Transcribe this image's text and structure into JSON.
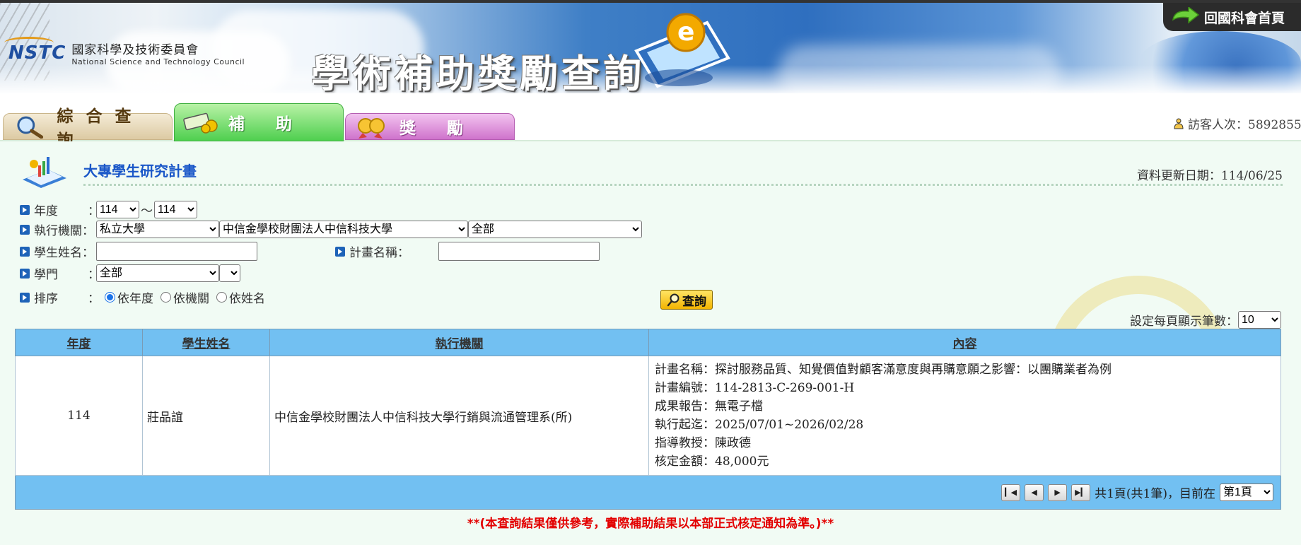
{
  "header": {
    "logo_mark": "NSTC",
    "logo_cn": "國家科學及技術委員會",
    "logo_en": "National Science and Technology Council",
    "site_title": "學術補助獎勵查詢",
    "home_link": "回國科會首頁"
  },
  "tabs": [
    {
      "label": "綜合查詢",
      "icon": "magnifier-icon",
      "color": "#dccaa3"
    },
    {
      "label": "補 助",
      "icon": "money-icon",
      "color": "#4fcf4f",
      "active": true
    },
    {
      "label": "獎 勵",
      "icon": "medal-icon",
      "color": "#cf73cc"
    }
  ],
  "visitor": {
    "label": "訪客人次：5892855"
  },
  "section": {
    "title": "大專學生研究計畫",
    "updated": "資料更新日期：114/06/25"
  },
  "form": {
    "year_label": "年度",
    "year_from": "114",
    "year_to": "114",
    "tilde": "～",
    "org_label": "執行機關：",
    "org_type": "私立大學",
    "org_name": "中信金學校財團法人中信科技大學",
    "org_dept": "全部",
    "student_label": "學生姓名：",
    "student_value": "",
    "project_label": "計畫名稱：",
    "project_value": "",
    "field_label": "學門",
    "field_value": "全部",
    "field_sub": "",
    "sort_label": "排序",
    "sort_options": [
      "依年度",
      "依機關",
      "依姓名"
    ],
    "sort_selected": "依年度",
    "search_button": "查詢",
    "colon": "："
  },
  "perpage": {
    "label": "設定每頁顯示筆數：",
    "value": "10"
  },
  "table": {
    "columns": [
      "年度",
      "學生姓名",
      "執行機關",
      "內容"
    ],
    "rows": [
      {
        "year": "114",
        "name": "莊品誼",
        "org": "中信金學校財團法人中信科技大學行銷與流通管理系(所)",
        "content": [
          "計畫名稱：探討服務品質、知覺價值對顧客滿意度與再購意願之影響：以團購業者為例",
          "計畫編號：114-2813-C-269-001-H",
          "成果報告：無電子檔",
          "執行起迄：2025/07/01~2026/02/28",
          "指導教授：陳政德",
          "核定金額：48,000元"
        ]
      }
    ]
  },
  "pager": {
    "summary": "共1頁(共1筆)，目前在",
    "page_select": "第1頁",
    "first": "first-page-icon",
    "prev": "prev-page-icon",
    "next": "next-page-icon",
    "last": "last-page-icon"
  },
  "disclaimer": "**(本查詢結果僅供參考，實際補助結果以本部正式核定通知為準。)**"
}
